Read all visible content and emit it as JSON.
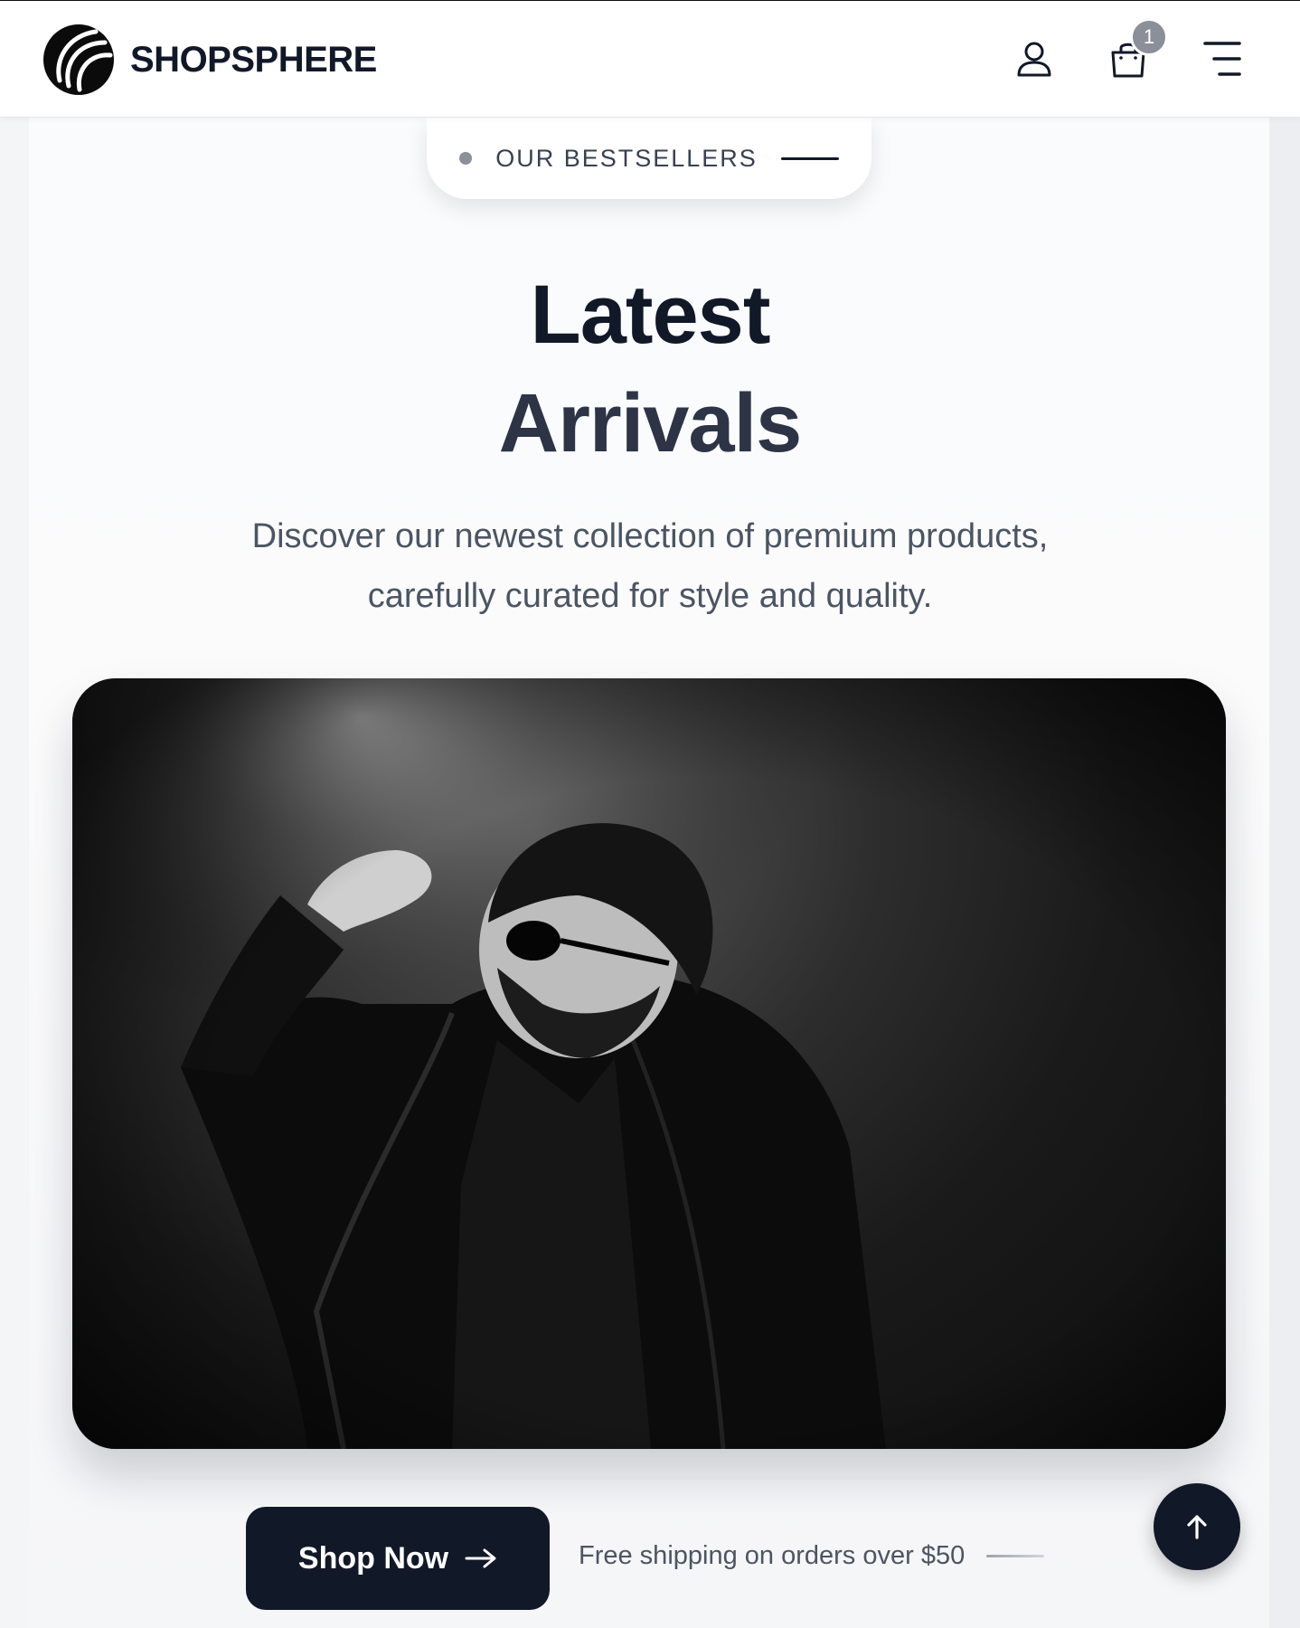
{
  "header": {
    "brand": "SHOPSPHERE",
    "cart_count": "1",
    "icons": [
      "user-icon",
      "shopping-bag-icon",
      "menu-icon"
    ]
  },
  "hero": {
    "eyebrow": "OUR BESTSELLERS",
    "title_line1": "Latest",
    "title_line2": "Arrivals",
    "subtitle_line1": "Discover our newest collection of premium products,",
    "subtitle_line2": "carefully curated for style and quality.",
    "image": "black-and-white portrait of a man in sunglasses and a dark jacket"
  },
  "cta": {
    "shop_label": "Shop Now",
    "shipping_note": "Free shipping on orders over $50"
  },
  "colors": {
    "primary": "#111827",
    "text_muted": "#4b5563",
    "badge": "#8b8f99",
    "background": "#f4f5f7"
  }
}
